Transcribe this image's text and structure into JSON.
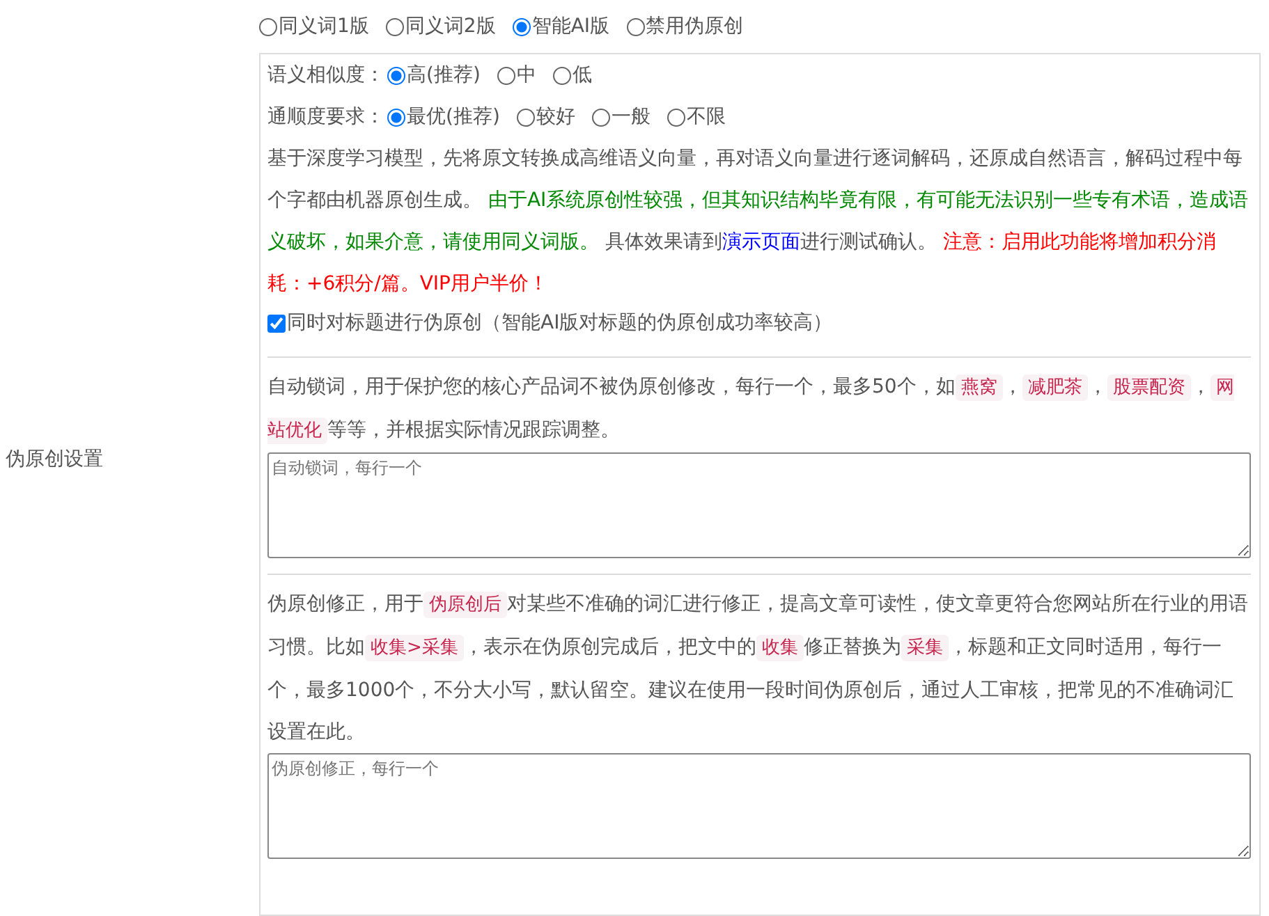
{
  "section_label": "伪原创设置",
  "modes": [
    {
      "label": "同义词1版",
      "selected": false
    },
    {
      "label": "同义词2版",
      "selected": false
    },
    {
      "label": "智能AI版",
      "selected": true
    },
    {
      "label": "禁用伪原创",
      "selected": false
    }
  ],
  "option_groups": [
    {
      "label": "语义相似度：",
      "options": [
        {
          "label": "高(推荐)",
          "selected": true
        },
        {
          "label": "中",
          "selected": false
        },
        {
          "label": "低",
          "selected": false
        }
      ]
    },
    {
      "label": "通顺度要求：",
      "options": [
        {
          "label": "最优(推荐)",
          "selected": true
        },
        {
          "label": "较好",
          "selected": false
        },
        {
          "label": "一般",
          "selected": false
        },
        {
          "label": "不限",
          "selected": false
        }
      ]
    }
  ],
  "ai_description": [
    {
      "kind": "plain",
      "text": "基于深度学习模型，先将原文转换成高维语义向量，再对语义向量进行逐词解码，还原成自然语言，解码过程中每个字都由机器原创生成。 "
    },
    {
      "kind": "note",
      "text": "由于AI系统原创性较强，但其知识结构毕竟有限，有可能无法识别一些专有术语，造成语义破坏，如果介意，请使用同义词版。"
    },
    {
      "kind": "plain",
      "text": " 具体效果请到"
    },
    {
      "kind": "link",
      "text": "演示页面"
    },
    {
      "kind": "plain",
      "text": "进行测试确认。 "
    },
    {
      "kind": "warning",
      "text": "注意：启用此功能将增加积分消耗：+6积分/篇。VIP用户半价！"
    }
  ],
  "title_checkbox": {
    "label": "同时对标题进行伪原创（智能AI版对标题的伪原创成功率较高）",
    "checked": true
  },
  "lock_words": {
    "description": [
      {
        "kind": "plain",
        "text": "自动锁词，用于保护您的核心产品词不被伪原创修改，每行一个，最多50个，如"
      },
      {
        "kind": "code",
        "text": "燕窝"
      },
      {
        "kind": "plain",
        "text": "，"
      },
      {
        "kind": "code",
        "text": "减肥茶"
      },
      {
        "kind": "plain",
        "text": "，"
      },
      {
        "kind": "code",
        "text": "股票配资"
      },
      {
        "kind": "plain",
        "text": "，"
      },
      {
        "kind": "code",
        "text": "网站优化"
      },
      {
        "kind": "plain",
        "text": "等等，并根据实际情况跟踪调整。"
      }
    ],
    "placeholder": "自动锁词，每行一个"
  },
  "corrections": {
    "description": [
      {
        "kind": "plain",
        "text": "伪原创修正，用于"
      },
      {
        "kind": "code",
        "text": "伪原创后"
      },
      {
        "kind": "plain",
        "text": "对某些不准确的词汇进行修正，提高文章可读性，使文章更符合您网站所在行业的用语习惯。比如"
      },
      {
        "kind": "code",
        "text": "收集>采集"
      },
      {
        "kind": "plain",
        "text": "，表示在伪原创完成后，把文中的"
      },
      {
        "kind": "code",
        "text": "收集"
      },
      {
        "kind": "plain",
        "text": "修正替换为"
      },
      {
        "kind": "code",
        "text": "采集"
      },
      {
        "kind": "plain",
        "text": "，标题和正文同时适用，每行一个，最多1000个，不分大小写，默认留空。建议在使用一段时间伪原创后，通过人工审核，把常见的不准确词汇设置在此。"
      }
    ],
    "placeholder": "伪原创修正，每行一个"
  }
}
